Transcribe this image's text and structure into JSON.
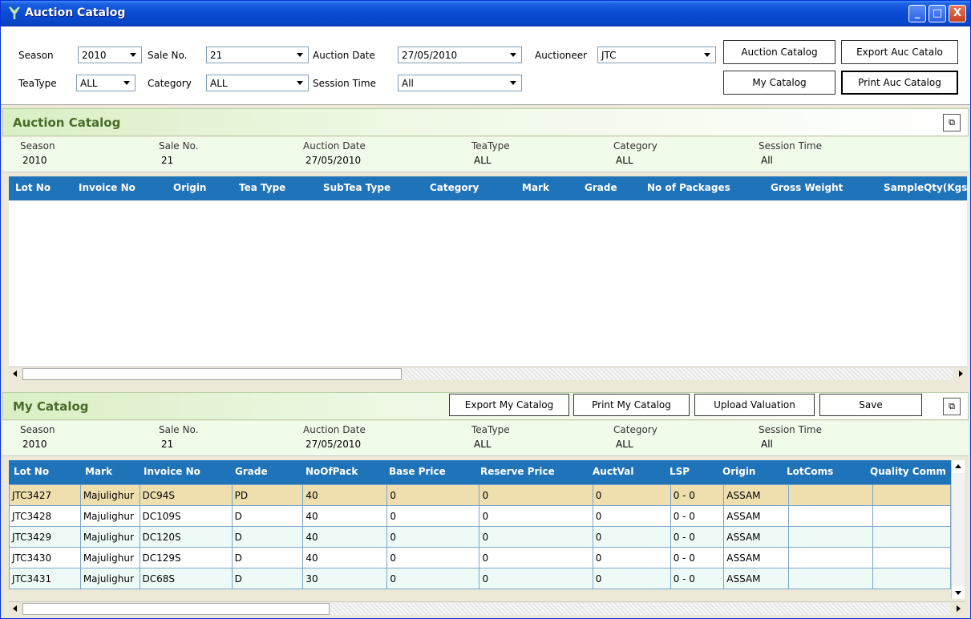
{
  "window": {
    "title": "Auction Catalog",
    "minimize": "_",
    "maximize": "□",
    "close": "X"
  },
  "filters": {
    "season_label": "Season",
    "season_value": "2010",
    "saleno_label": "Sale No.",
    "saleno_value": "21",
    "auction_date_label": "Auction Date",
    "auction_date_value": "27/05/2010",
    "auctioneer_label": "Auctioneer",
    "auctioneer_value": "JTC",
    "teatype_label": "TeaType",
    "teatype_value": "ALL",
    "category_label": "Category",
    "category_value": "ALL",
    "session_label": "Session Time",
    "session_value": "All"
  },
  "buttons": {
    "auction_catalog": "Auction Catalog",
    "export_auc_catalog": "Export Auc Catalo",
    "my_catalog": "My Catalog",
    "print_auc_catalog": "Print Auc Catalog",
    "export_my_catalog": "Export My Catalog",
    "print_my_catalog": "Print My Catalog",
    "upload_valuation": "Upload Valuation",
    "save": "Save"
  },
  "auction_section": {
    "title": "Auction Catalog",
    "info": [
      {
        "k": "Season",
        "v": "2010"
      },
      {
        "k": "Sale No.",
        "v": "21"
      },
      {
        "k": "Auction Date",
        "v": "27/05/2010"
      },
      {
        "k": "TeaType",
        "v": "ALL"
      },
      {
        "k": "Category",
        "v": "ALL"
      },
      {
        "k": "Session Time",
        "v": "All"
      }
    ],
    "columns": [
      "Lot No",
      "Invoice No",
      "Origin",
      "Tea Type",
      "SubTea Type",
      "Category",
      "Mark",
      "Grade",
      "No of Packages",
      "Gross Weight",
      "SampleQty(Kgs)"
    ]
  },
  "my_section": {
    "title": "My Catalog",
    "info": [
      {
        "k": "Season",
        "v": "2010"
      },
      {
        "k": "Sale No.",
        "v": "21"
      },
      {
        "k": "Auction Date",
        "v": "27/05/2010"
      },
      {
        "k": "TeaType",
        "v": "ALL"
      },
      {
        "k": "Category",
        "v": "ALL"
      },
      {
        "k": "Session Time",
        "v": "All"
      }
    ],
    "columns": [
      "Lot No",
      "Mark",
      "Invoice No",
      "Grade",
      "NoOfPack",
      "Base Price",
      "Reserve Price",
      "AuctVal",
      "LSP",
      "Origin",
      "LotComs",
      "Quality Comm"
    ],
    "rows": [
      [
        "JTC3427",
        "Majulighur",
        "DC94S",
        "PD",
        "40",
        "0",
        "0",
        "0",
        "0 - 0",
        "ASSAM",
        "",
        ""
      ],
      [
        "JTC3428",
        "Majulighur",
        "DC109S",
        "D",
        "40",
        "0",
        "0",
        "0",
        "0 - 0",
        "ASSAM",
        "",
        ""
      ],
      [
        "JTC3429",
        "Majulighur",
        "DC120S",
        "D",
        "40",
        "0",
        "0",
        "0",
        "0 - 0",
        "ASSAM",
        "",
        ""
      ],
      [
        "JTC3430",
        "Majulighur",
        "DC129S",
        "D",
        "40",
        "0",
        "0",
        "0",
        "0 - 0",
        "ASSAM",
        "",
        ""
      ],
      [
        "JTC3431",
        "Majulighur",
        "DC68S",
        "D",
        "30",
        "0",
        "0",
        "0",
        "0 - 0",
        "ASSAM",
        "",
        ""
      ]
    ]
  },
  "colors": {
    "title_bar": "#0a4bd5",
    "grid_header": "#1f73b8",
    "section_title": "#4b6b2a",
    "selected_row": "#efdfae"
  },
  "icons": {
    "app": "tea-leaf-icon",
    "restore": "restore-window-icon"
  }
}
